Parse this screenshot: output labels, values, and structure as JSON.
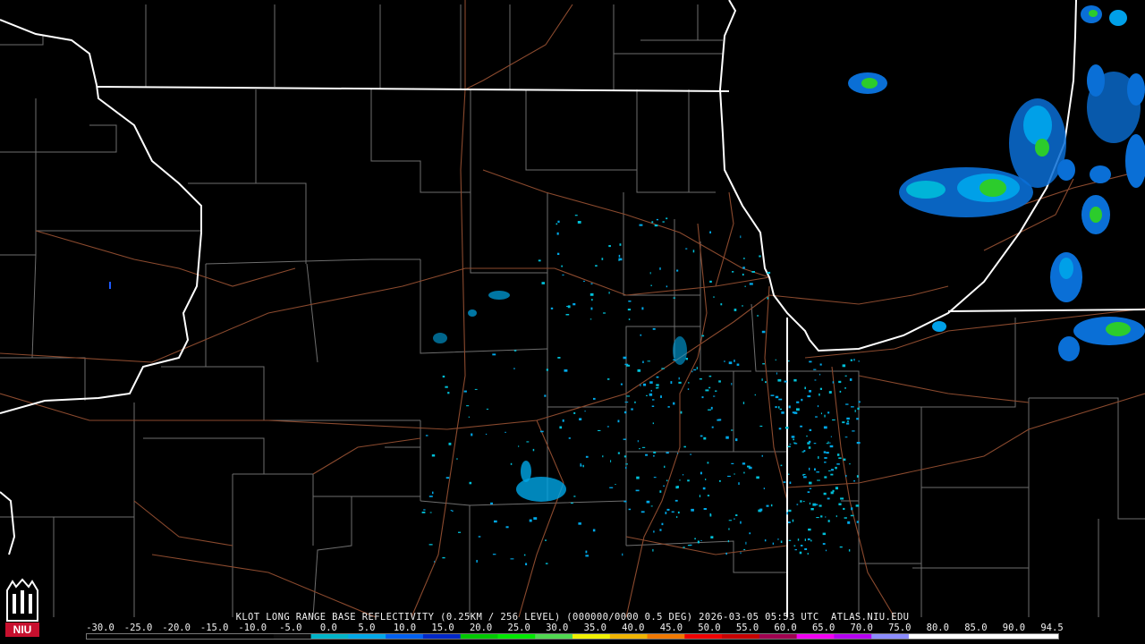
{
  "product": {
    "caption": "KLOT LONG RANGE BASE REFLECTIVITY (0.25KM / 256 LEVEL) (000000/0000 0.5 DEG) 2026-03-05 05:53 UTC  ATLAS.NIU.EDU"
  },
  "legend": {
    "ticks": [
      "-30.0",
      "-25.0",
      "-20.0",
      "-15.0",
      "-10.0",
      "-5.0",
      "0.0",
      "5.0",
      "10.0",
      "15.0",
      "20.0",
      "25.0",
      "30.0",
      "35.0",
      "40.0",
      "45.0",
      "50.0",
      "55.0",
      "60.0",
      "65.0",
      "70.0",
      "75.0",
      "80.0",
      "85.0",
      "90.0",
      "94.5"
    ],
    "unit_scale": "dBZ",
    "colors": [
      "#000000",
      "#000000",
      "#000000",
      "#000000",
      "#000000",
      "#0a0a0a",
      "#00b4c8",
      "#00a8e8",
      "#0060f0",
      "#0028c8",
      "#00c800",
      "#00e800",
      "#50d850",
      "#f0f000",
      "#f0b400",
      "#f07800",
      "#f00000",
      "#c80000",
      "#a00050",
      "#f000f0",
      "#b400f0",
      "#8c8cff",
      "#ffffff",
      "#ffffff",
      "#ffffff",
      "#ffffff"
    ]
  },
  "branding": {
    "logo_text": "NIU",
    "logo_color": "#c8102e"
  },
  "map_colors": {
    "state_border": "#ffffff",
    "county_border": "#6e6e6e",
    "highway": "#8b4a2e",
    "background": "#000000"
  }
}
